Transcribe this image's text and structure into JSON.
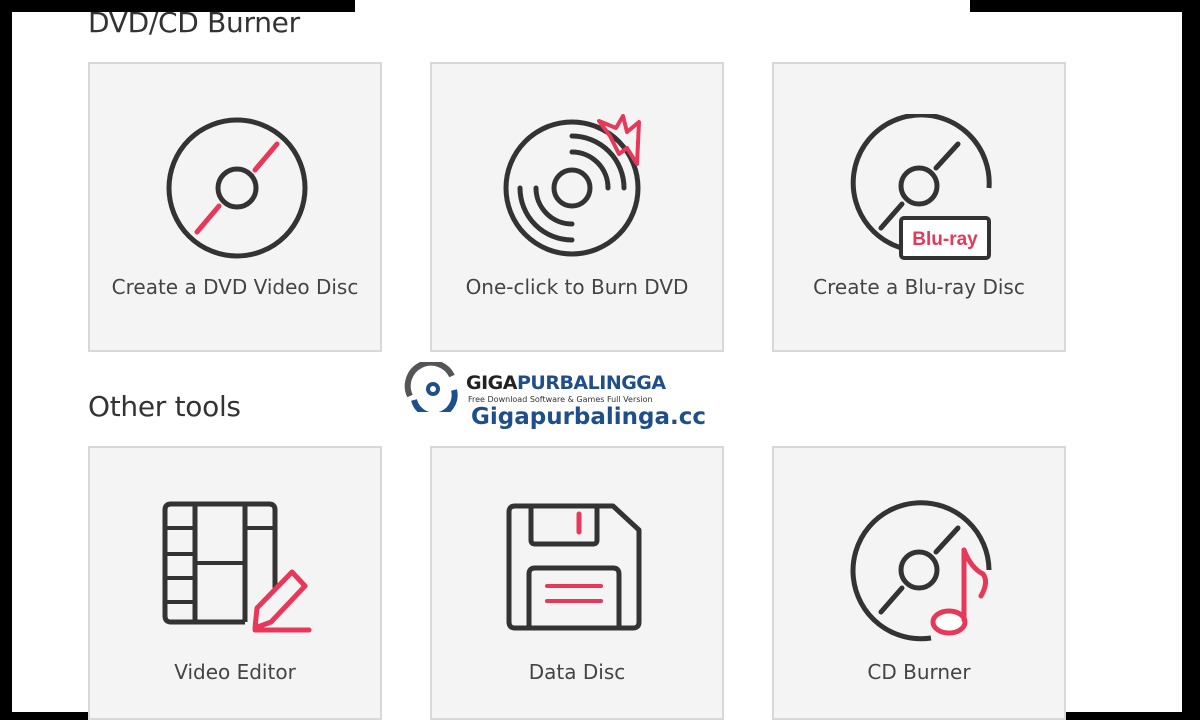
{
  "colors": {
    "accent": "#e8385a",
    "stroke": "#333333",
    "card_bg": "#f4f4f4",
    "brand_blue": "#1e4f8c"
  },
  "sections": {
    "burner": {
      "title": "DVD/CD Burner"
    },
    "tools": {
      "title": "Other tools"
    }
  },
  "cards": {
    "create_dvd": {
      "label": "Create a DVD Video Disc",
      "icon": "dvd-disc-icon"
    },
    "one_click": {
      "label": "One-click to Burn DVD",
      "icon": "burning-disc-icon"
    },
    "bluray": {
      "label": "Create a Blu-ray Disc",
      "icon": "bluray-disc-icon",
      "badge": "Blu-ray"
    },
    "video_editor": {
      "label": "Video Editor",
      "icon": "film-edit-icon"
    },
    "data_disc": {
      "label": "Data Disc",
      "icon": "floppy-disk-icon"
    },
    "cd_burner": {
      "label": "CD Burner",
      "icon": "music-disc-icon"
    }
  },
  "watermark": {
    "brand_part1": "GIGA",
    "brand_part2": "PURBALINGGA",
    "tagline": "Free Download Software & Games Full Version",
    "url": "Gigapurbalinga.cc"
  }
}
